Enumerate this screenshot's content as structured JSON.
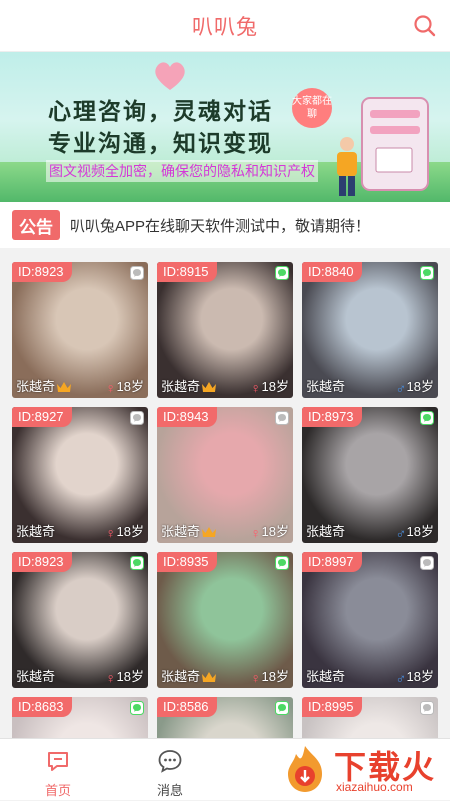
{
  "header": {
    "title": "叭叭兔"
  },
  "banner": {
    "headline_1": "心理咨询，灵魂对话",
    "headline_2": "专业沟通，知识变现",
    "subline": "图文视频全加密，确保您的隐私和知识产权",
    "badge": "大家都在聊"
  },
  "notice": {
    "tag": "公告",
    "text": "叭叭兔APP在线聊天软件测试中，敬请期待！"
  },
  "cards": [
    {
      "id": "ID:8923",
      "name": "张越奇",
      "age": "18岁",
      "gender": "female",
      "crown": true,
      "chat_active": false,
      "c1": "#8a6d5a",
      "c2": "#d8c6b6"
    },
    {
      "id": "ID:8915",
      "name": "张越奇",
      "age": "18岁",
      "gender": "female",
      "crown": true,
      "chat_active": true,
      "c1": "#3a3030",
      "c2": "#cbbab0"
    },
    {
      "id": "ID:8840",
      "name": "张越奇",
      "age": "18岁",
      "gender": "male",
      "crown": false,
      "chat_active": true,
      "c1": "#4a4a52",
      "c2": "#b8c4d0"
    },
    {
      "id": "ID:8927",
      "name": "张越奇",
      "age": "18岁",
      "gender": "female",
      "crown": false,
      "chat_active": false,
      "c1": "#3b3030",
      "c2": "#e2d4cc"
    },
    {
      "id": "ID:8943",
      "name": "张越奇",
      "age": "18岁",
      "gender": "female",
      "crown": true,
      "chat_active": false,
      "c1": "#b7a39a",
      "c2": "#e6a8ac"
    },
    {
      "id": "ID:8973",
      "name": "张越奇",
      "age": "18岁",
      "gender": "male",
      "crown": false,
      "chat_active": true,
      "c1": "#2d2a2a",
      "c2": "#a8a4a6"
    },
    {
      "id": "ID:8923",
      "name": "张越奇",
      "age": "18岁",
      "gender": "female",
      "crown": false,
      "chat_active": true,
      "c1": "#2f2a2a",
      "c2": "#d9cdc6"
    },
    {
      "id": "ID:8935",
      "name": "张越奇",
      "age": "18岁",
      "gender": "female",
      "crown": true,
      "chat_active": true,
      "c1": "#6e5b4a",
      "c2": "#8fc49a"
    },
    {
      "id": "ID:8997",
      "name": "张越奇",
      "age": "18岁",
      "gender": "male",
      "crown": false,
      "chat_active": false,
      "c1": "#3a3440",
      "c2": "#8a8c98"
    },
    {
      "id": "ID:8683",
      "name": "",
      "age": "",
      "gender": "",
      "crown": false,
      "chat_active": true,
      "c1": "#c9bfc0",
      "c2": "#efe6e4"
    },
    {
      "id": "ID:8586",
      "name": "",
      "age": "",
      "gender": "",
      "crown": false,
      "chat_active": true,
      "c1": "#8a9a8a",
      "c2": "#d9d6cc"
    },
    {
      "id": "ID:8995",
      "name": "",
      "age": "",
      "gender": "",
      "crown": false,
      "chat_active": false,
      "c1": "#c8c2c2",
      "c2": "#eee8e6"
    }
  ],
  "tabbar": {
    "home_label": "首页",
    "messages_label": "消息"
  },
  "watermark": {
    "text": "下载火",
    "url": "xiazaihuo.com"
  },
  "colors": {
    "accent": "#f06a6a",
    "female": "#ff5a6a",
    "male": "#4a90e2",
    "chat_green": "#4cd964",
    "crown_gold": "#f5a623"
  }
}
